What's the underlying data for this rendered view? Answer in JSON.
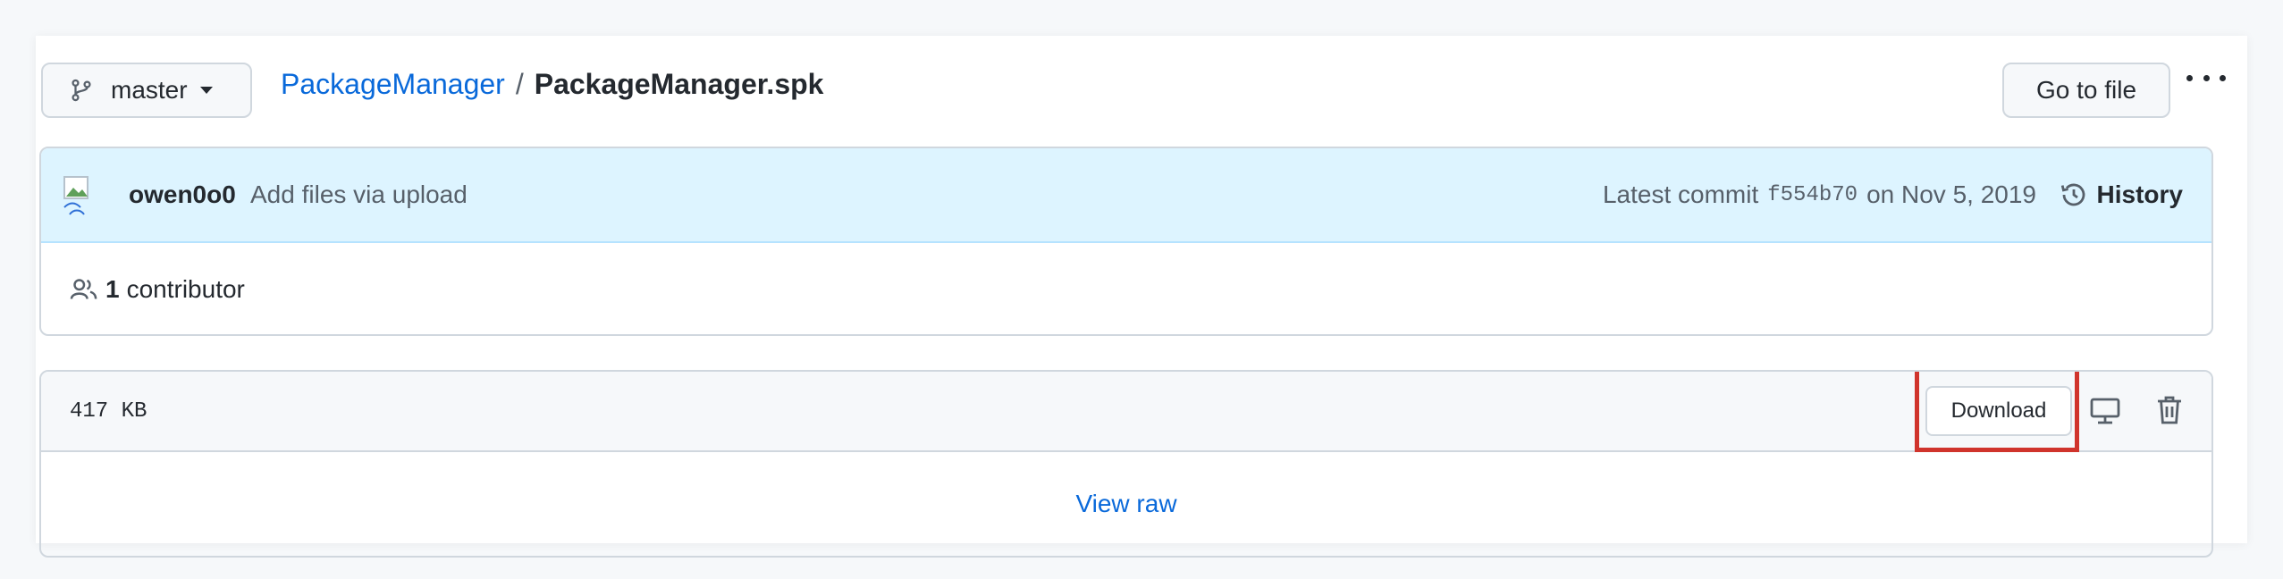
{
  "header": {
    "branch_label": "master",
    "breadcrumb": {
      "repo": "PackageManager",
      "separator": "/",
      "file": "PackageManager.spk"
    },
    "goto_label": "Go to file"
  },
  "commit": {
    "author": "owen0o0",
    "message": "Add files via upload",
    "latest_prefix": "Latest commit",
    "sha": "f554b70",
    "date": "on Nov 5, 2019",
    "history_label": "History"
  },
  "contributors": {
    "count": "1",
    "label": "contributor"
  },
  "file": {
    "size": "417 KB",
    "download_label": "Download",
    "view_raw_label": "View raw"
  },
  "colors": {
    "link": "#0969da",
    "highlight": "#d0342c",
    "commit_bg": "#ddf4ff"
  }
}
